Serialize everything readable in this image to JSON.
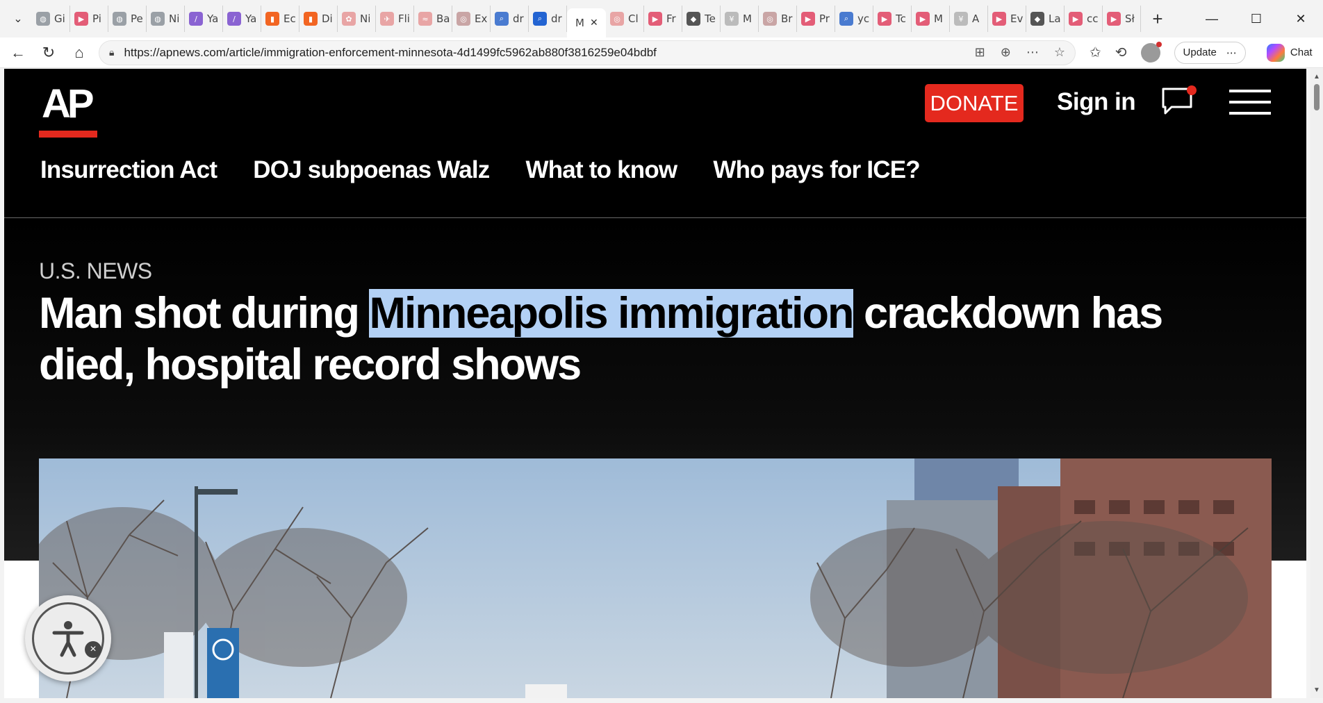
{
  "browser": {
    "tabs": [
      {
        "label": "Gi",
        "icon": "globe-icon",
        "color": "#9aa0a6"
      },
      {
        "label": "Pi",
        "icon": "youtube-icon",
        "color": "#e35d77"
      },
      {
        "label": "Pe",
        "icon": "globe-icon",
        "color": "#9aa0a6"
      },
      {
        "label": "Ni",
        "icon": "globe-icon",
        "color": "#9aa0a6"
      },
      {
        "label": "Ya",
        "icon": "yahoo-icon",
        "color": "#8a63d2"
      },
      {
        "label": "Ya",
        "icon": "yahoo-icon",
        "color": "#8a63d2"
      },
      {
        "label": "Ec",
        "icon": "bookmark-icon",
        "color": "#f26522"
      },
      {
        "label": "Di",
        "icon": "bookmark-icon",
        "color": "#f26522"
      },
      {
        "label": "Ni",
        "icon": "maple-icon",
        "color": "#e8a5a5"
      },
      {
        "label": "Fli",
        "icon": "plane-icon",
        "color": "#e8a5a5"
      },
      {
        "label": "Ba",
        "icon": "wing-icon",
        "color": "#e8a5a5"
      },
      {
        "label": "Ex",
        "icon": "seal-icon",
        "color": "#c9a5a5"
      },
      {
        "label": "dr",
        "icon": "search-icon",
        "color": "#4a7bd0"
      },
      {
        "label": "dr",
        "icon": "search-icon",
        "color": "#2364d2"
      },
      {
        "label": "M",
        "icon": "ap-icon",
        "color": "#222222",
        "active": true
      },
      {
        "label": "Cl",
        "icon": "seal-icon",
        "color": "#e8a5a5"
      },
      {
        "label": "Fr",
        "icon": "youtube-icon",
        "color": "#e35d77"
      },
      {
        "label": "Te",
        "icon": "diamond-icon",
        "color": "#555555"
      },
      {
        "label": "M",
        "icon": "cny-icon",
        "color": "#bbbbbb"
      },
      {
        "label": "Br",
        "icon": "seal-icon",
        "color": "#c9a5a5"
      },
      {
        "label": "Pr",
        "icon": "youtube-icon",
        "color": "#e35d77"
      },
      {
        "label": "yc",
        "icon": "search-icon",
        "color": "#4a7bd0"
      },
      {
        "label": "Tc",
        "icon": "youtube-icon",
        "color": "#e35d77"
      },
      {
        "label": "M",
        "icon": "youtube-icon",
        "color": "#e35d77"
      },
      {
        "label": "A",
        "icon": "cny-icon",
        "color": "#bbbbbb"
      },
      {
        "label": "Ev",
        "icon": "youtube-icon",
        "color": "#e35d77"
      },
      {
        "label": "La",
        "icon": "diamond-icon",
        "color": "#555555"
      },
      {
        "label": "cc",
        "icon": "youtube-icon",
        "color": "#e35d77"
      },
      {
        "label": "Sł",
        "icon": "youtube-icon",
        "color": "#e35d77"
      }
    ],
    "url": "https://apnews.com/article/immigration-enforcement-minnesota-4d1499fc5962ab880f3816259e04bdbf",
    "update_label": "Update",
    "chat_label": "Chat"
  },
  "site": {
    "logo_text": "AP",
    "donate_label": "DONATE",
    "signin_label": "Sign in",
    "topics": [
      "Insurrection Act",
      "DOJ subpoenas Walz",
      "What to know",
      "Who pays for ICE?"
    ],
    "brand_red": "#e4291e"
  },
  "article": {
    "section": "U.S. NEWS",
    "headline_before": "Man shot during ",
    "headline_highlight": "Minneapolis immigration",
    "headline_after": " crackdown has died, hospital record shows",
    "highlight_color": "#b3d1f5"
  }
}
